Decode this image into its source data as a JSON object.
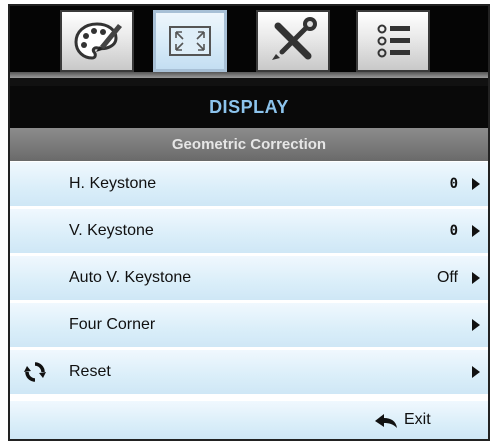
{
  "tabs": [
    {
      "icon": "palette-icon",
      "active": false
    },
    {
      "icon": "display-screen-icon",
      "active": true
    },
    {
      "icon": "tools-icon",
      "active": false
    },
    {
      "icon": "list-menu-icon",
      "active": false
    }
  ],
  "menu": {
    "title": "DISPLAY",
    "subtitle": "Geometric Correction",
    "items": [
      {
        "label": "H. Keystone",
        "value": "0"
      },
      {
        "label": "V. Keystone",
        "value": "0"
      },
      {
        "label": "Auto V. Keystone",
        "value": "Off"
      },
      {
        "label": "Four Corner",
        "value": ""
      },
      {
        "label": "Reset",
        "value": ""
      }
    ],
    "exit_label": "Exit"
  },
  "colors": {
    "title_text": "#8cc3ec",
    "active_tab_border": "#a8c0d6",
    "row_background": "#daeef9"
  }
}
